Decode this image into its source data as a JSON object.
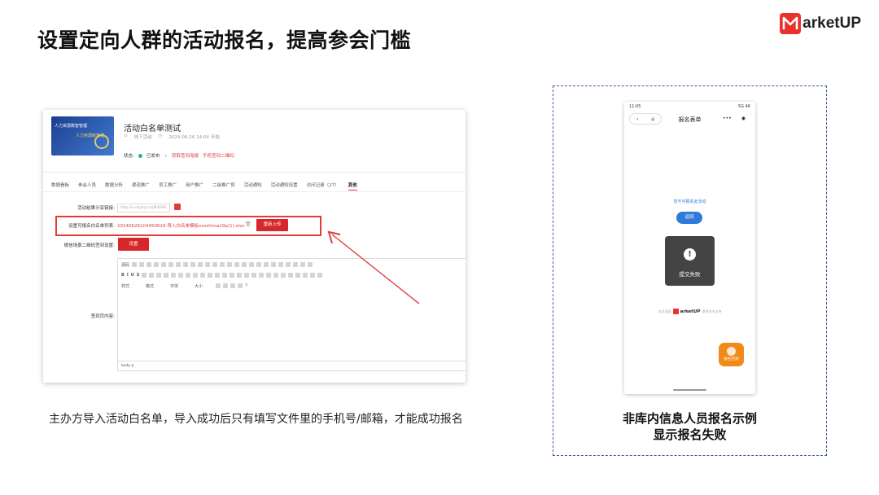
{
  "slide": {
    "title": "设置定向人群的活动报名，提高参会门槛",
    "caption_left": "主办方导入活动白名单，导入成功后只有填写文件里的手机号/邮箱，才能成功报名",
    "caption_right_line1": "非库内信息人员报名示例",
    "caption_right_line2": "显示报名失败"
  },
  "brand": {
    "name": "arketUP",
    "color": "#e8332d"
  },
  "event": {
    "poster_text_1": "人力资源数智管理",
    "poster_text_2": "人力资源新管理",
    "title": "活动白名单测试",
    "type": "线下活动",
    "start_time": "2024-06-26 14:04 开始",
    "status_label": "状态:",
    "status_value": "已发布",
    "link_get_qr": "获取签到海报",
    "link_manual_signin": "手机签到二维码"
  },
  "tabs": [
    "数据看板",
    "参会人员",
    "数据分析",
    "渠道推广",
    "员工推广",
    "用户推广",
    "二级推广员",
    "活动通知",
    "活动通知设置",
    "访问记录（27）",
    "其他"
  ],
  "form": {
    "share_link_label": "活动结果分享链接:",
    "share_link_value": "http://u.cqyhy.cn/jM4OHE",
    "whitelist_label": "设置可报名白名单列表:",
    "whitelist_file": "20240626104450616-导入白名单模板xzxzhhsa29p(1).xlsx",
    "reupload_button": "重新上传",
    "wechat_qr_label": "微信场景二维码签到设置:",
    "setting_button": "设置",
    "signin_content_label": "签到页内容:",
    "editor_source": "源码",
    "editor_style": "样式",
    "editor_format": "格式",
    "editor_font": "字体",
    "editor_size": "大小",
    "editor_footer": "body  p"
  },
  "phone": {
    "status_time": "11:05",
    "status_right": "5G 46",
    "nav_title": "报名表单",
    "notice": "您不可报名此活动",
    "back_button": "返回",
    "toast_text": "提交失败",
    "footer_left": "本页面由",
    "footer_brand": "arketUP",
    "footer_right": "提供技术支持",
    "float_button": "报名咨询"
  }
}
